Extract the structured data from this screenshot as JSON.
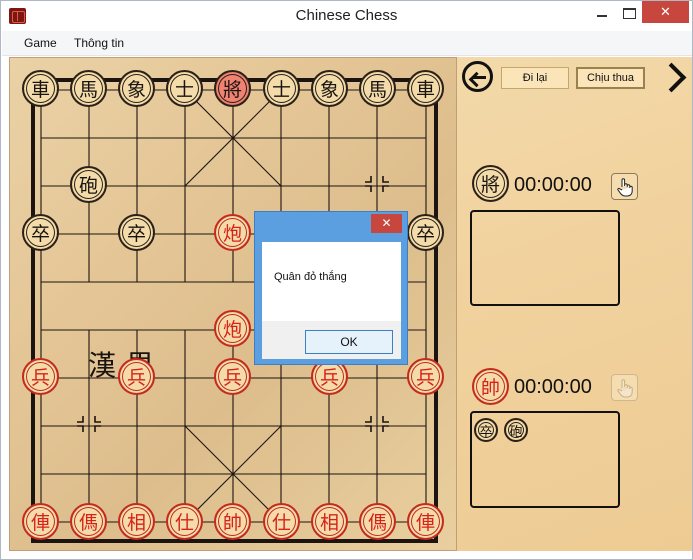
{
  "window": {
    "title": "Chinese Chess",
    "close_glyph": "✕"
  },
  "menu": {
    "game": "Game",
    "info": "Thông tin"
  },
  "board": {
    "river_text": "漢界",
    "black_back_rank": [
      "車",
      "馬",
      "象",
      "士",
      "將",
      "士",
      "象",
      "馬",
      "車"
    ],
    "black_cannon": "砲",
    "black_soldiers": [
      "卒",
      "卒",
      "卒"
    ],
    "red_cannons": [
      "炮",
      "炮"
    ],
    "red_soldiers": [
      "兵",
      "兵",
      "兵",
      "兵",
      "兵"
    ],
    "red_back_rank": [
      "俥",
      "傌",
      "相",
      "仕",
      "帥",
      "仕",
      "相",
      "傌",
      "俥"
    ]
  },
  "side_panel": {
    "undo_label": "Đi lại",
    "resign_label": "Chịu thua",
    "black_player": {
      "piece": "將",
      "timer": "00:00:00",
      "captured": []
    },
    "red_player": {
      "piece": "帥",
      "timer": "00:00:00",
      "captured": [
        "卒",
        "砲"
      ]
    }
  },
  "dialog": {
    "message": "Quân đỏ thắng",
    "ok_label": "OK",
    "close_glyph": "✕"
  },
  "colors": {
    "red_piece": "#d8211b",
    "black_piece": "#1a1410",
    "highlight": "#f08272",
    "dialog_accent": "#5b9fe0"
  }
}
